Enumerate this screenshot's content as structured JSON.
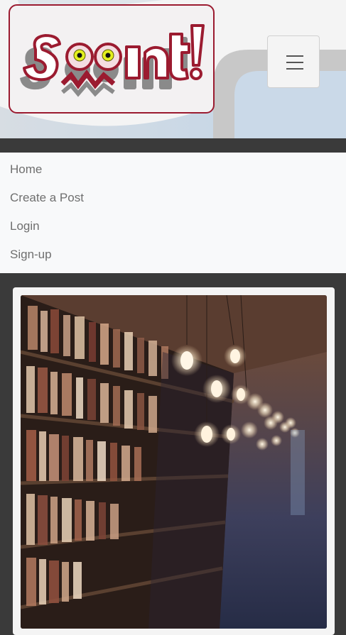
{
  "brand": {
    "logo_text": "Seenit!"
  },
  "header": {
    "menu_toggle_icon": "hamburger-icon"
  },
  "nav": {
    "items": [
      {
        "label": "Home"
      },
      {
        "label": "Create a Post"
      },
      {
        "label": "Login"
      },
      {
        "label": "Sign-up"
      }
    ]
  },
  "hero": {
    "image_subject": "library-bookshelves-with-hanging-bulbs"
  },
  "colors": {
    "brand_red": "#9b1b30",
    "nav_background": "#f8f9fa",
    "nav_text": "#6f6f6f",
    "page_background": "#3a3a3a"
  }
}
